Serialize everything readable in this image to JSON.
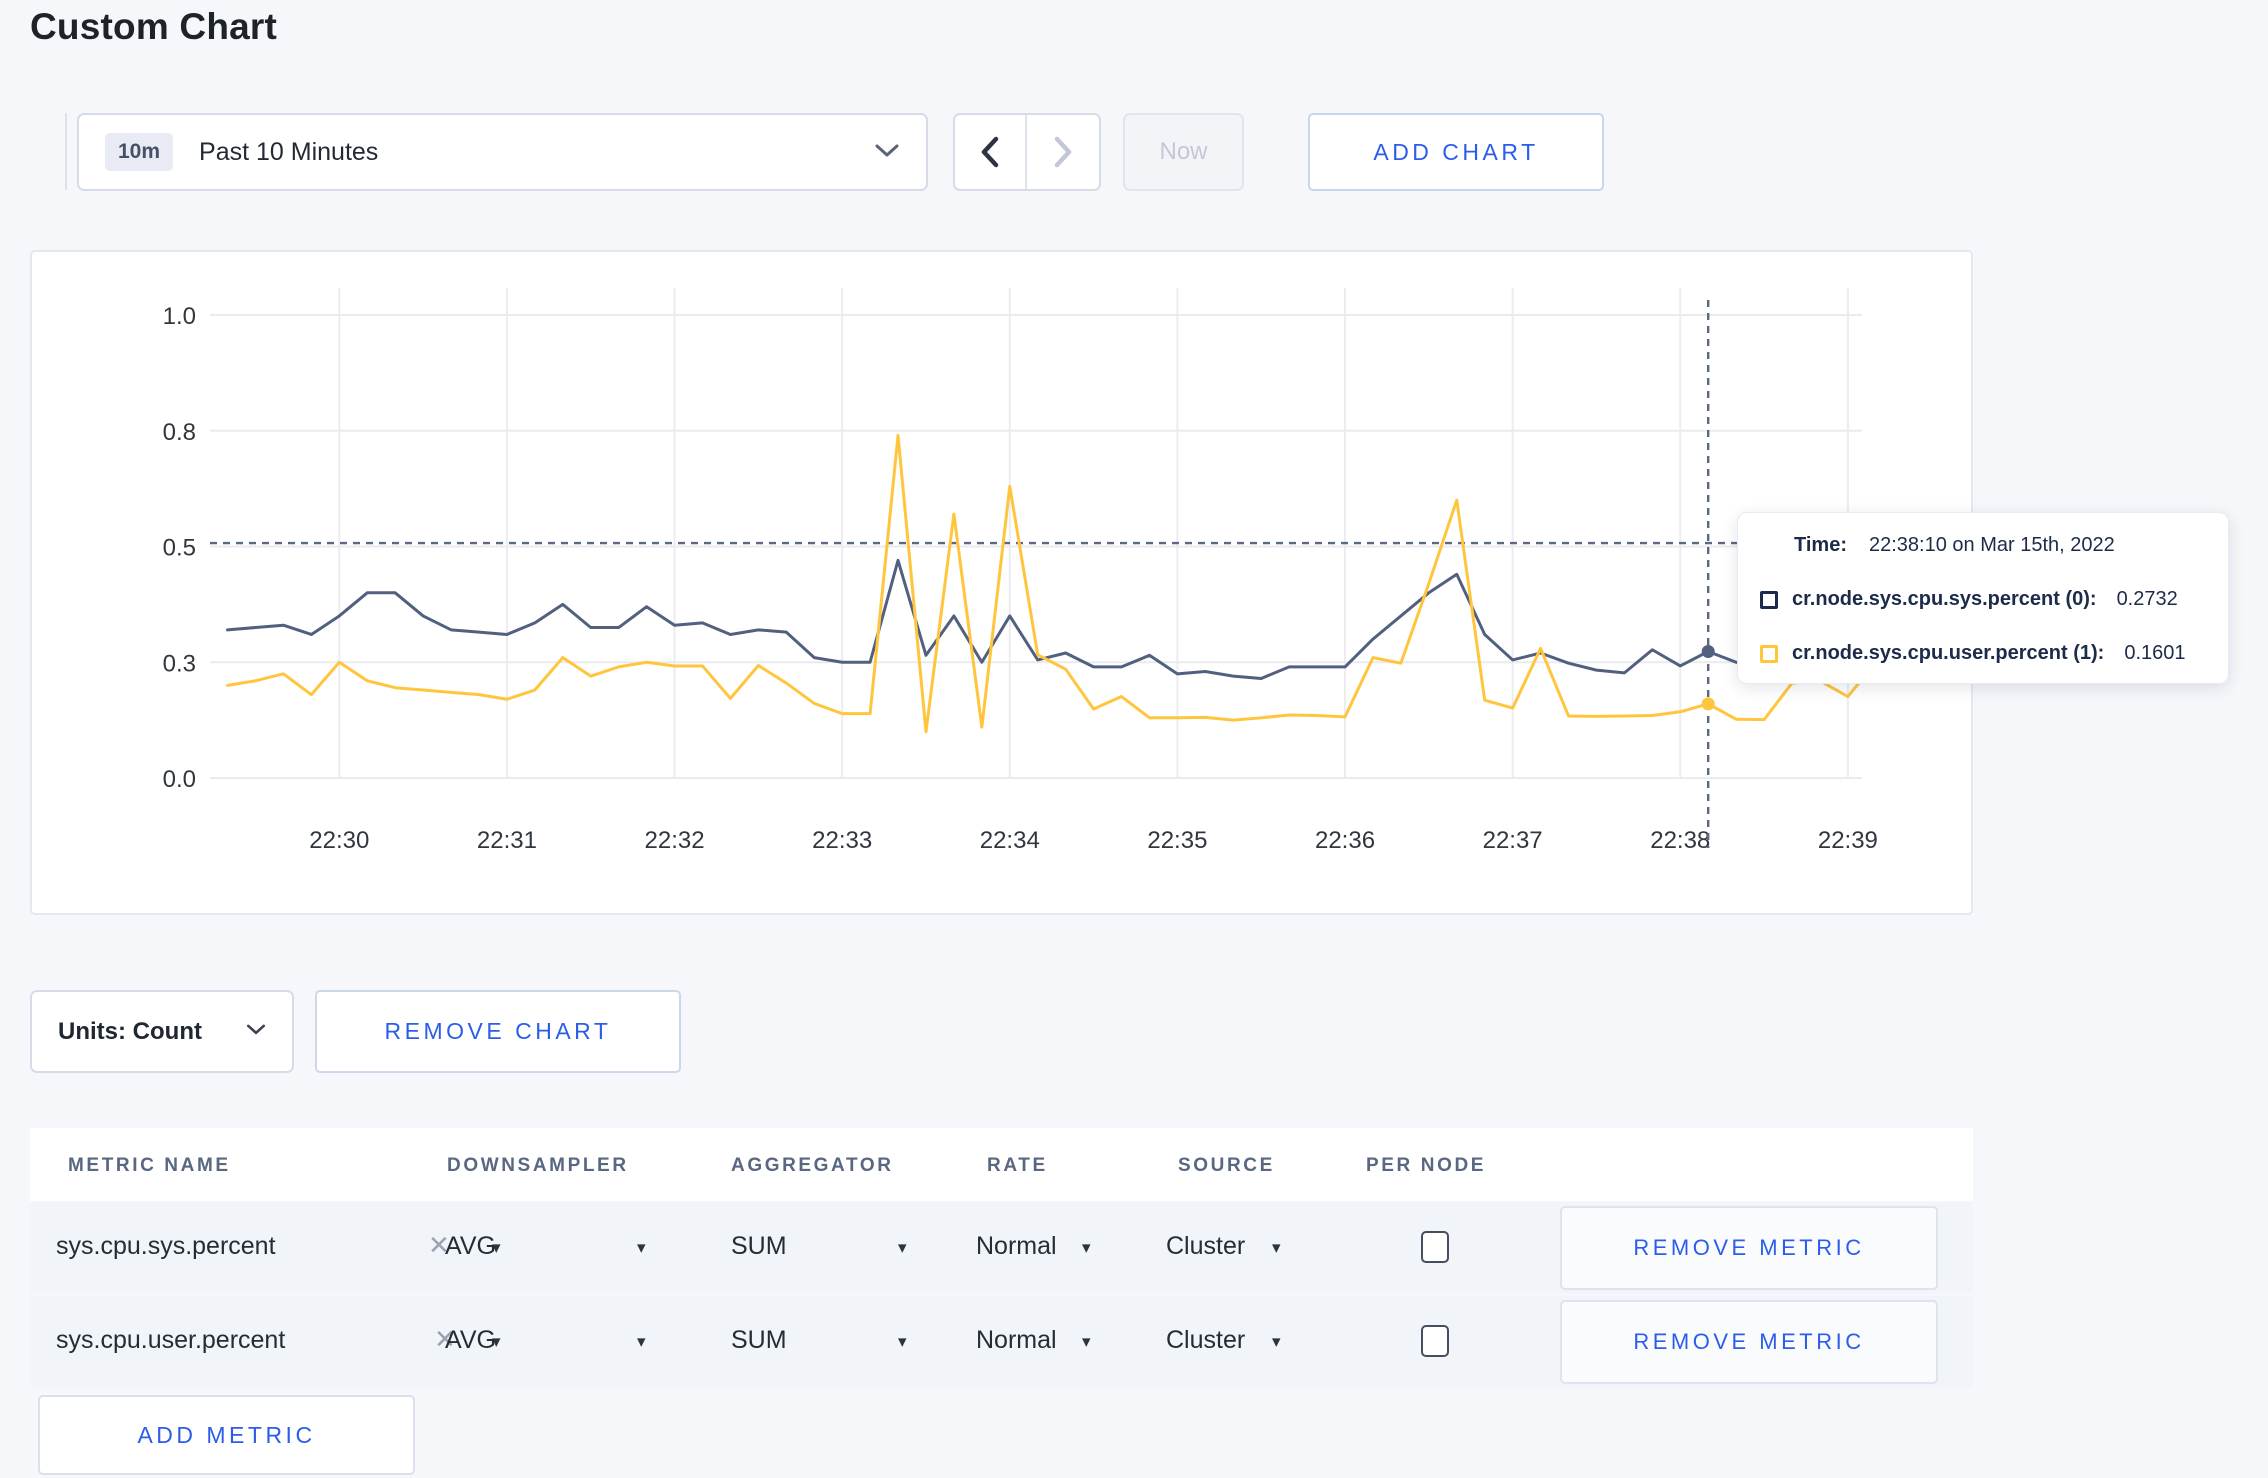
{
  "page": {
    "title": "Custom Chart"
  },
  "toolbar": {
    "time_range": {
      "badge": "10m",
      "label": "Past 10 Minutes"
    },
    "now_label": "Now",
    "add_chart_label": "ADD CHART"
  },
  "icons": {
    "dropdown_caret": "▾",
    "clear": "✕"
  },
  "tooltip": {
    "time_label": "Time:",
    "time_value": "22:38:10 on Mar 15th, 2022",
    "series": [
      {
        "name": "cr.node.sys.cpu.sys.percent (0):",
        "value": "0.2732",
        "color": "#1b2b4e"
      },
      {
        "name": "cr.node.sys.cpu.user.percent (1):",
        "value": "0.1601",
        "color": "#ffc53d"
      }
    ]
  },
  "units_bar": {
    "units_label": "Units: Count",
    "remove_chart_label": "REMOVE CHART"
  },
  "metrics_table": {
    "headers": [
      "METRIC NAME",
      "DOWNSAMPLER",
      "AGGREGATOR",
      "RATE",
      "SOURCE",
      "PER NODE"
    ],
    "rows": [
      {
        "metric": "sys.cpu.sys.percent",
        "downsampler": "AVG",
        "aggregator": "SUM",
        "rate": "Normal",
        "source": "Cluster",
        "per_node_checked": false,
        "remove_label": "REMOVE METRIC"
      },
      {
        "metric": "sys.cpu.user.percent",
        "downsampler": "AVG",
        "aggregator": "SUM",
        "rate": "Normal",
        "source": "Cluster",
        "per_node_checked": false,
        "remove_label": "REMOVE METRIC"
      }
    ],
    "add_metric_label": "ADD METRIC"
  },
  "chart_data": {
    "type": "line",
    "title": "",
    "xlabel": "",
    "ylabel": "",
    "ylim": [
      0,
      1
    ],
    "grid": true,
    "y_tick_values": [
      1.0,
      0.75,
      0.5,
      0.25,
      0.0
    ],
    "y_tick_labels": [
      "1.0",
      "0.8",
      "0.5",
      "0.3",
      "0.0"
    ],
    "x_tick_labels": [
      "22:30",
      "22:31",
      "22:32",
      "22:33",
      "22:34",
      "22:35",
      "22:36",
      "22:37",
      "22:38",
      "22:39"
    ],
    "x_interval_seconds": 10,
    "x_times": [
      "22:29:20",
      "22:29:30",
      "22:29:40",
      "22:29:50",
      "22:30:00",
      "22:30:10",
      "22:30:20",
      "22:30:30",
      "22:30:40",
      "22:30:50",
      "22:31:00",
      "22:31:10",
      "22:31:20",
      "22:31:30",
      "22:31:40",
      "22:31:50",
      "22:32:00",
      "22:32:10",
      "22:32:20",
      "22:32:30",
      "22:32:40",
      "22:32:50",
      "22:33:00",
      "22:33:10",
      "22:33:20",
      "22:33:30",
      "22:33:40",
      "22:33:50",
      "22:34:00",
      "22:34:10",
      "22:34:20",
      "22:34:30",
      "22:34:40",
      "22:34:50",
      "22:35:00",
      "22:35:10",
      "22:35:20",
      "22:35:30",
      "22:35:40",
      "22:35:50",
      "22:36:00",
      "22:36:10",
      "22:36:20",
      "22:36:30",
      "22:36:40",
      "22:36:50",
      "22:37:00",
      "22:37:10",
      "22:37:20",
      "22:37:30",
      "22:37:40",
      "22:37:50",
      "22:38:00",
      "22:38:10",
      "22:38:20",
      "22:38:30",
      "22:38:40",
      "22:38:50",
      "22:39:00",
      "22:39:10"
    ],
    "series": [
      {
        "name": "cr.node.sys.cpu.sys.percent",
        "color": "#51607e",
        "values": [
          0.32,
          0.325,
          0.33,
          0.31,
          0.35,
          0.4,
          0.4,
          0.35,
          0.32,
          0.315,
          0.31,
          0.335,
          0.375,
          0.325,
          0.325,
          0.37,
          0.33,
          0.335,
          0.31,
          0.32,
          0.315,
          0.26,
          0.25,
          0.25,
          0.47,
          0.265,
          0.35,
          0.25,
          0.35,
          0.255,
          0.27,
          0.24,
          0.24,
          0.265,
          0.225,
          0.23,
          0.22,
          0.215,
          0.24,
          0.24,
          0.24,
          0.3,
          0.35,
          0.4,
          0.44,
          0.31,
          0.255,
          0.27,
          0.248,
          0.233,
          0.227,
          0.277,
          0.242,
          0.2732,
          0.25,
          0.24,
          0.255,
          0.265,
          0.275,
          0.3
        ]
      },
      {
        "name": "cr.node.sys.cpu.user.percent",
        "color": "#ffc53d",
        "values": [
          0.2,
          0.21,
          0.225,
          0.18,
          0.25,
          0.21,
          0.195,
          0.19,
          0.185,
          0.18,
          0.17,
          0.19,
          0.26,
          0.22,
          0.24,
          0.25,
          0.242,
          0.242,
          0.172,
          0.243,
          0.205,
          0.161,
          0.139,
          0.139,
          0.74,
          0.1,
          0.57,
          0.11,
          0.63,
          0.266,
          0.235,
          0.149,
          0.176,
          0.13,
          0.13,
          0.131,
          0.125,
          0.13,
          0.136,
          0.135,
          0.132,
          0.26,
          0.248,
          0.42,
          0.6,
          0.168,
          0.151,
          0.28,
          0.134,
          0.133,
          0.134,
          0.135,
          0.143,
          0.1601,
          0.127,
          0.126,
          0.205,
          0.21,
          0.176,
          0.25
        ]
      }
    ],
    "crosshair": {
      "time_label": "22:38:10",
      "time_index": 53,
      "hline_value": 0.5075
    },
    "legend_position": "tooltip"
  }
}
